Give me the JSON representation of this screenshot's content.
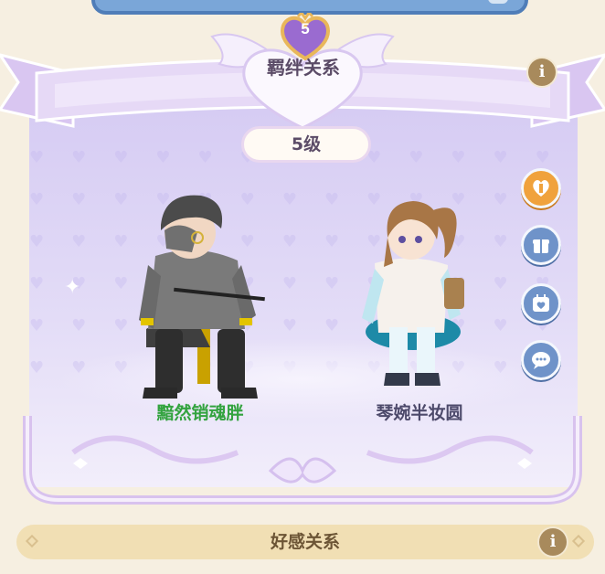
{
  "header": {
    "level_badge": "5",
    "title": "羁绊关系",
    "level_label": "5级"
  },
  "characters": [
    {
      "name": "黯然销魂胖",
      "color": "#33a33f"
    },
    {
      "name": "琴婉半妆圆",
      "color": "#4d4a6b"
    }
  ],
  "side_buttons": [
    {
      "icon": "heart-gift-icon"
    },
    {
      "icon": "gift-box-icon"
    },
    {
      "icon": "calendar-heart-icon"
    },
    {
      "icon": "chat-bubble-icon"
    }
  ],
  "info_icon": "i",
  "footer": {
    "label": "好感关系",
    "info_icon": "i"
  },
  "colors": {
    "panel": "#e3dcf7",
    "ribbon": "#e6d9f6",
    "bottom_bar": "#f1dfb4",
    "button_blue": "#6f93c9",
    "button_gold": "#f0a23c"
  }
}
